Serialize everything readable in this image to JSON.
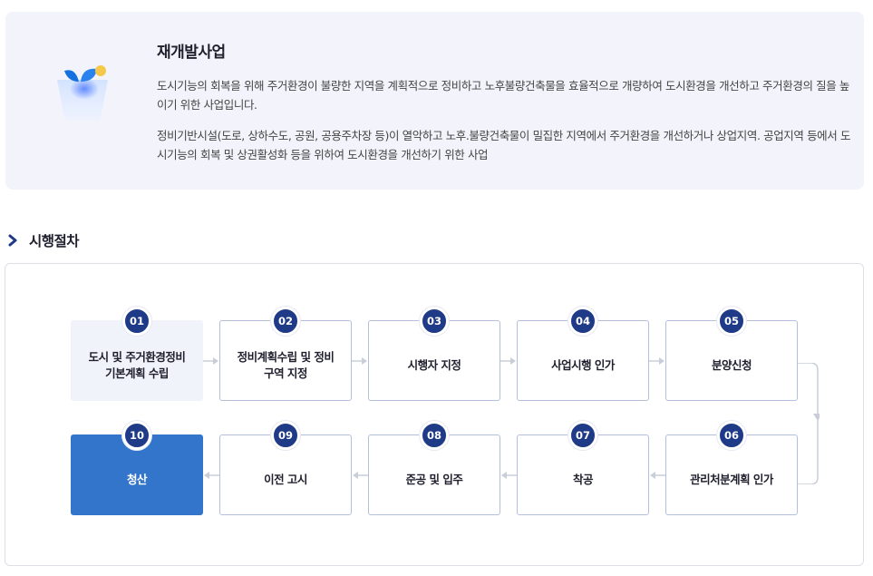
{
  "intro": {
    "title": "재개발사업",
    "paragraph1": "도시기능의 회복을 위해 주거환경이 불량한 지역을 계획적으로 정비하고 노후불량건축물을 효율적으로 개량하여 도시환경을 개선하고 주거환경의 질을 높이기 위한 사업입니다.",
    "paragraph2": "정비기반시설(도로, 상하수도, 공원, 공용주차장 등)이 열악하고 노후.불량건축물이 밀집한 지역에서 주거환경을 개선하거나 상업지역. 공업지역 등에서 도시기능의 회복 및 상권활성화 등을 위하여 도시환경을 개선하기 위한 사업"
  },
  "section": {
    "title": "시행절차"
  },
  "steps": [
    {
      "num": "01",
      "label": "도시 및 주거환경정비\n기본계획 수립",
      "state": "active"
    },
    {
      "num": "02",
      "label": "정비계획수립 및 정비\n구역 지정",
      "state": "normal"
    },
    {
      "num": "03",
      "label": "시행자 지정",
      "state": "normal"
    },
    {
      "num": "04",
      "label": "사업시행 인가",
      "state": "normal"
    },
    {
      "num": "05",
      "label": "분양신청",
      "state": "normal"
    },
    {
      "num": "06",
      "label": "관리처분계획 인가",
      "state": "normal"
    },
    {
      "num": "07",
      "label": "착공",
      "state": "normal"
    },
    {
      "num": "08",
      "label": "준공 및 입주",
      "state": "normal"
    },
    {
      "num": "09",
      "label": "이전 고시",
      "state": "normal"
    },
    {
      "num": "10",
      "label": "청산",
      "state": "done"
    }
  ],
  "colors": {
    "badge": "#1f3a87",
    "done": "#3475cc",
    "active_bg": "#f1f3fb",
    "border": "#b3bfdc"
  }
}
